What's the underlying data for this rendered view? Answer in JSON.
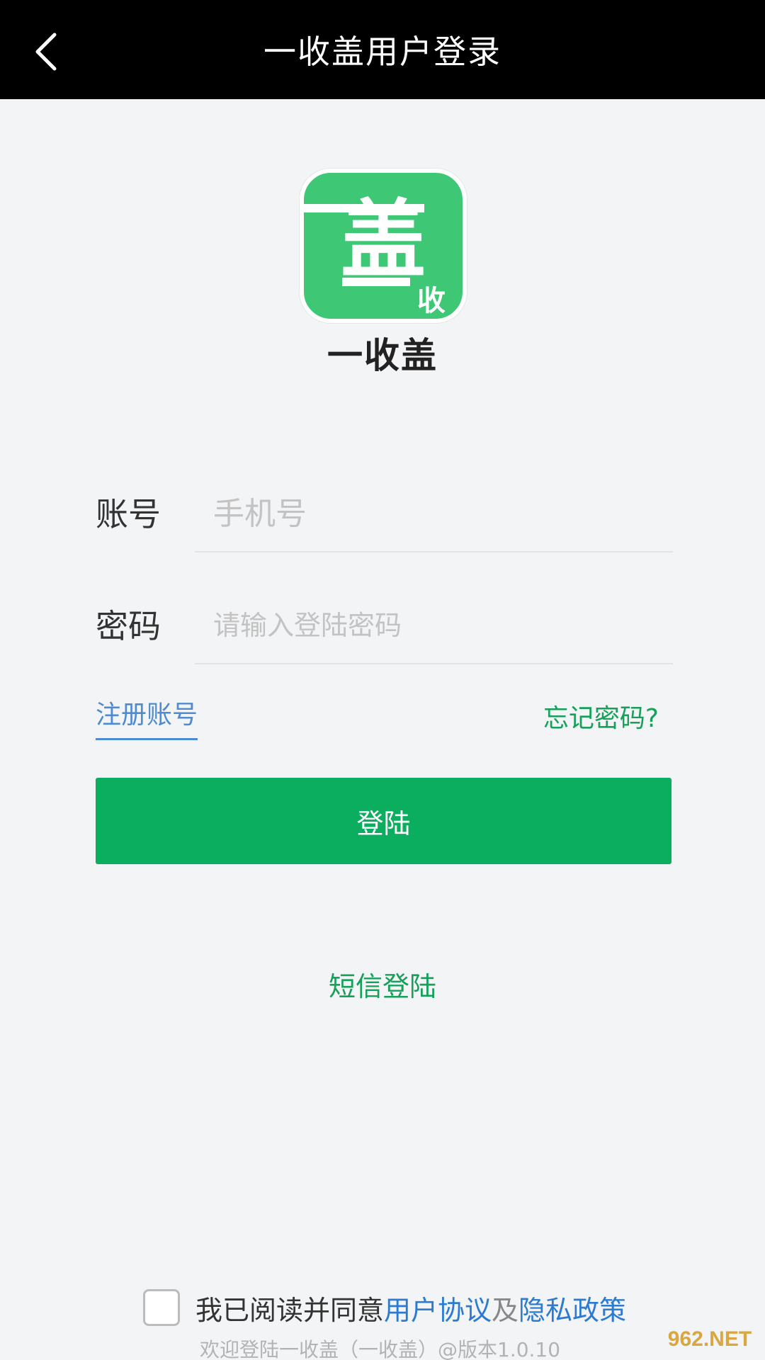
{
  "header": {
    "title": "一收盖用户登录",
    "back_icon": "chevron-left-icon"
  },
  "app": {
    "logo_icon": "app-logo-icon",
    "logo_main_char": "盖",
    "logo_small_char": "收",
    "name": "一收盖",
    "brand_color": "#3ec775"
  },
  "form": {
    "account_label": "账号",
    "account_placeholder": "手机号",
    "account_value": "",
    "password_label": "密码",
    "password_placeholder": "请输入登陆密码",
    "password_value": ""
  },
  "links": {
    "register": "注册账号",
    "forgot": "忘记密码?",
    "sms_login": "短信登陆"
  },
  "login_button": {
    "label": "登陆",
    "color": "#0bae5f"
  },
  "agreement": {
    "checked": false,
    "prefix": "我已阅读并同意",
    "user_agreement": "用户协议",
    "and": "及",
    "privacy_policy": "隐私政策"
  },
  "footer": {
    "text": "欢迎登陆一收盖（一收盖）@版本1.0.10"
  },
  "watermark": {
    "text": "962.NET"
  }
}
